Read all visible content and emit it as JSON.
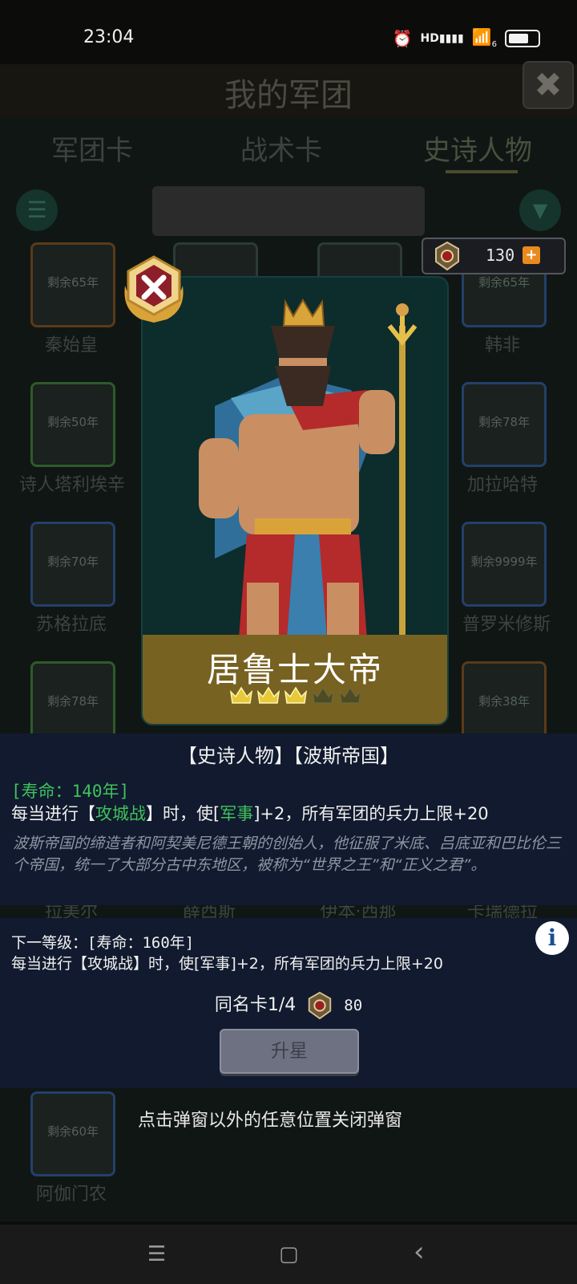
{
  "status_bar": {
    "time": "23:04",
    "signal_label": "HD",
    "wifi_label": "6"
  },
  "header": {
    "title": "我的军团",
    "close_label": "✖"
  },
  "tabs": [
    {
      "label": "军团卡",
      "active": false
    },
    {
      "label": "战术卡",
      "active": false
    },
    {
      "label": "史诗人物",
      "active": true
    }
  ],
  "currency": {
    "value": "130",
    "plus": "+"
  },
  "background_cards": [
    {
      "remaining": "剩余65年",
      "name": "秦始皇"
    },
    {
      "remaining": "剩余65年",
      "name": "韩非"
    },
    {
      "remaining": "剩余50年",
      "name": "诗人塔利埃辛"
    },
    {
      "remaining": "剩余78年",
      "name": "加拉哈特"
    },
    {
      "remaining": "剩余70年",
      "name": "苏格拉底"
    },
    {
      "remaining": "剩余9999年",
      "name": "普罗米修斯"
    },
    {
      "remaining": "剩余78年",
      "name": ""
    },
    {
      "remaining": "剩余38年",
      "name": ""
    },
    {
      "remaining": "",
      "name": "拉美尔"
    },
    {
      "remaining": "",
      "name": "薛西斯"
    },
    {
      "remaining": "",
      "name": "伊本·西那"
    },
    {
      "remaining": "",
      "name": "卡瑞德拉"
    },
    {
      "remaining": "剩余60年",
      "name": "阿伽门农"
    }
  ],
  "hero": {
    "name": "居鲁士大帝",
    "stars_total": 5,
    "stars_filled": 3,
    "tags": "【史诗人物】【波斯帝国】",
    "life": "[寿命：140年]",
    "effect_parts": {
      "a": "每当进行【",
      "b": "攻城战",
      "c": "】时，使[",
      "d": "军事",
      "e": "]+2，所有军团的兵力上限+20"
    },
    "description": "波斯帝国的缔造者和阿契美尼德王朝的创始人，他征服了米底、吕底亚和巴比伦三个帝国，统一了大部分古中东地区，被称为“世界之王”和“正义之君”。"
  },
  "next_level": {
    "life": "下一等级：[寿命：160年]",
    "effect": "每当进行【攻城战】时，使[军事]+2，所有军团的兵力上限+20"
  },
  "duplicate": {
    "label": "同名卡1/4",
    "cost": "80"
  },
  "upgrade_button": "升星",
  "hint": "点击弹窗以外的任意位置关闭弹窗",
  "nav": {
    "menu": "☰",
    "home": "▢",
    "back": "‹"
  },
  "colors": {
    "highlight_green": "#3ec25c",
    "panel_bg": "#111a2e",
    "name_band": "#786221",
    "crown_gold": "#e8c93a"
  }
}
